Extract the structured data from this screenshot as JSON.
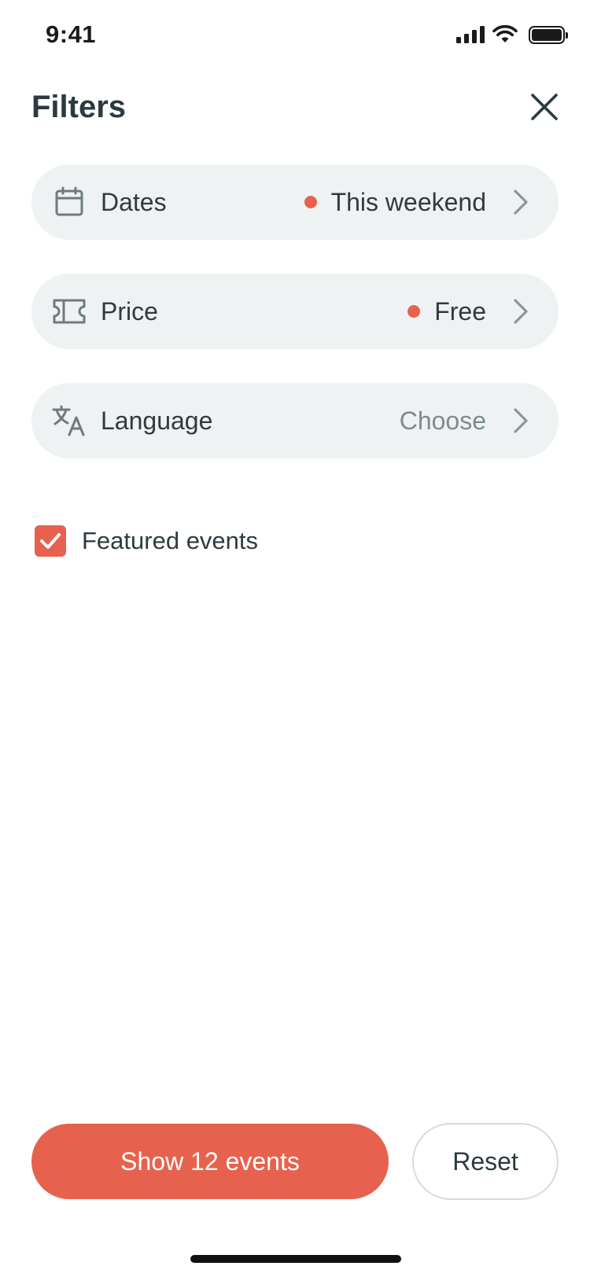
{
  "status_bar": {
    "time": "9:41",
    "icons": [
      "signal-icon",
      "wifi-icon",
      "battery-icon"
    ]
  },
  "header": {
    "title": "Filters",
    "close_icon": "close-icon"
  },
  "filters": [
    {
      "key": "dates",
      "icon": "calendar-icon",
      "label": "Dates",
      "value": "This weekend",
      "active": true
    },
    {
      "key": "price",
      "icon": "ticket-icon",
      "label": "Price",
      "value": "Free",
      "active": true
    },
    {
      "key": "language",
      "icon": "translate-icon",
      "label": "Language",
      "value": "Choose",
      "active": false
    }
  ],
  "featured": {
    "label": "Featured events",
    "checked": true
  },
  "footer": {
    "primary_label": "Show 12 events",
    "secondary_label": "Reset"
  },
  "colors": {
    "accent": "#e6624e",
    "row_background": "#eef2f3",
    "text": "#2f3b3f",
    "muted_text": "#7d8b8f",
    "icon": "#6e7b7f"
  }
}
